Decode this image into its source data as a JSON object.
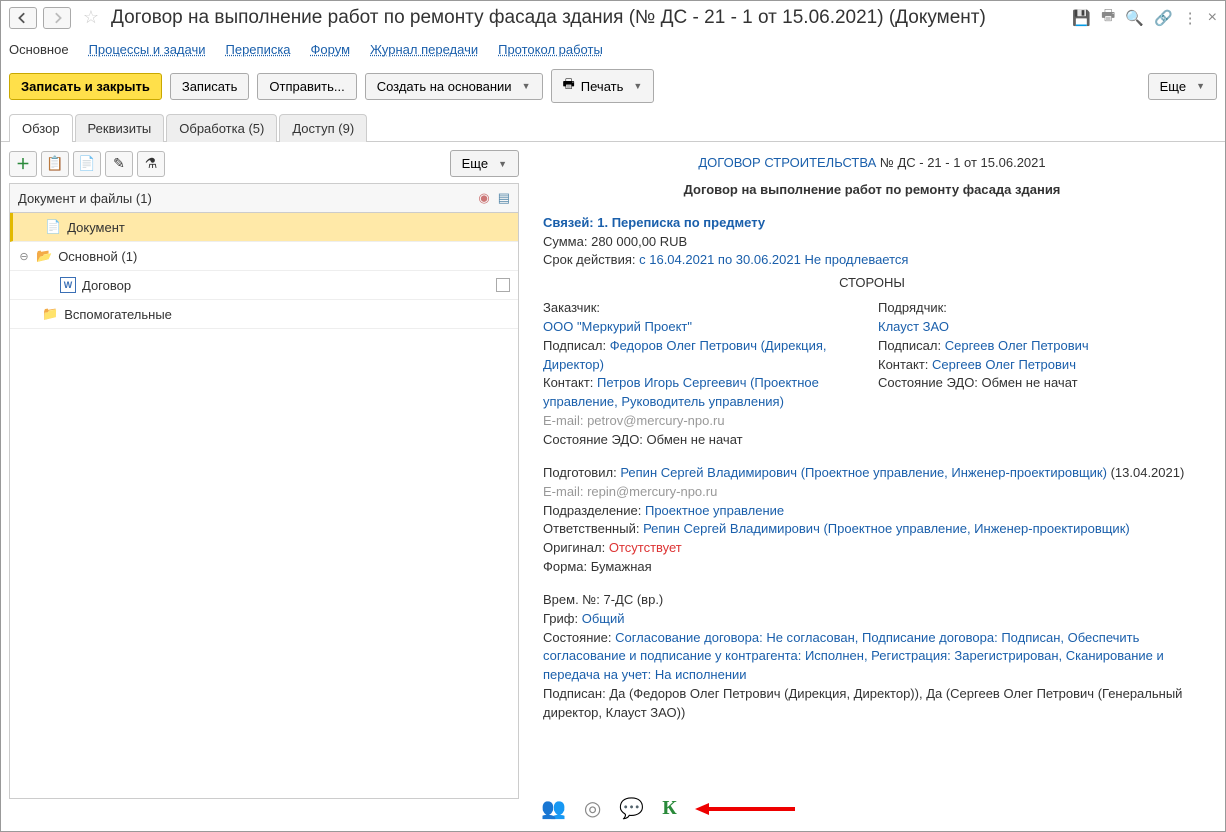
{
  "title": "Договор  на  выполнение работ по ремонту фасада здания (№ ДС - 21 - 1 от 15.06.2021) (Документ)",
  "menu": {
    "main": "Основное",
    "proc": "Процессы и задачи",
    "corr": "Переписка",
    "forum": "Форум",
    "transfer": "Журнал передачи",
    "proto": "Протокол работы"
  },
  "toolbar": {
    "save_close": "Записать и закрыть",
    "save": "Записать",
    "send": "Отправить...",
    "create": "Создать на основании",
    "print": "Печать",
    "more": "Еще"
  },
  "tabs": {
    "overview": "Обзор",
    "props": "Реквизиты",
    "processing": "Обработка (5)",
    "access": "Доступ (9)"
  },
  "tree": {
    "header": "Документ и файлы (1)",
    "doc": "Документ",
    "main_folder": "Основной (1)",
    "contract": "Договор",
    "aux": "Вспомогательные"
  },
  "doc": {
    "type": "ДОГОВОР СТРОИТЕЛЬСТВА",
    "num": "№ ДС - 21 - 1 от 15.06.2021",
    "title": "Договор на выполнение работ по ремонту фасада здания",
    "links_label": "Связей: 1. Переписка по предмету",
    "sum_label": "Сумма:",
    "sum": "280 000,00 RUB",
    "validity_label": "Срок действия:",
    "validity": "с 16.04.2021 по 30.06.2021 Не продлевается",
    "parties_title": "СТОРОНЫ",
    "customer": {
      "role": "Заказчик:",
      "org": "ООО \"Меркурий Проект\"",
      "signed_label": "Подписал:",
      "signed": "Федоров Олег Петрович (Дирекция, Директор)",
      "contact_label": "Контакт:",
      "contact": "Петров Игорь Сергеевич (Проектное управление, Руководитель управления)",
      "email_label": "E-mail:",
      "email": "petrov@mercury-npo.ru",
      "edo_label": "Состояние ЭДО:",
      "edo": "Обмен не начат"
    },
    "contractor": {
      "role": "Подрядчик:",
      "org": "Клауст ЗАО",
      "signed_label": "Подписал:",
      "signed": "Сергеев Олег Петрович",
      "contact_label": "Контакт:",
      "contact": "Сергеев Олег Петрович",
      "edo_label": "Состояние ЭДО:",
      "edo": "Обмен не начат"
    },
    "prepared_label": "Подготовил:",
    "prepared": "Репин Сергей Владимирович (Проектное управление, Инженер-проектировщик)",
    "prepared_date": "(13.04.2021)",
    "email2_label": "E-mail:",
    "email2": "repin@mercury-npo.ru",
    "dept_label": "Подразделение:",
    "dept": "Проектное управление",
    "resp_label": "Ответственный:",
    "resp": "Репин Сергей Владимирович (Проектное управление, Инженер-проектировщик)",
    "orig_label": "Оригинал:",
    "orig": "Отсутствует",
    "form_label": "Форма:",
    "form": "Бумажная",
    "temp_label": "Врем. №:",
    "temp": "7-ДС (вр.)",
    "grif_label": "Гриф:",
    "grif": "Общий",
    "state_label": "Состояние:",
    "state": "Согласование договора: Не согласован, Подписание договора: Подписан, Обеспечить согласование и подписание у контрагента: Исполнен, Регистрация: Зарегистрирован, Сканирование и передача на учет: На исполнении",
    "signed_full_label": "Подписан:",
    "signed_full": "Да (Федоров Олег Петрович (Дирекция, Директор)), Да (Сергеев Олег Петрович (Генеральный директор, Клауст ЗАО))"
  }
}
